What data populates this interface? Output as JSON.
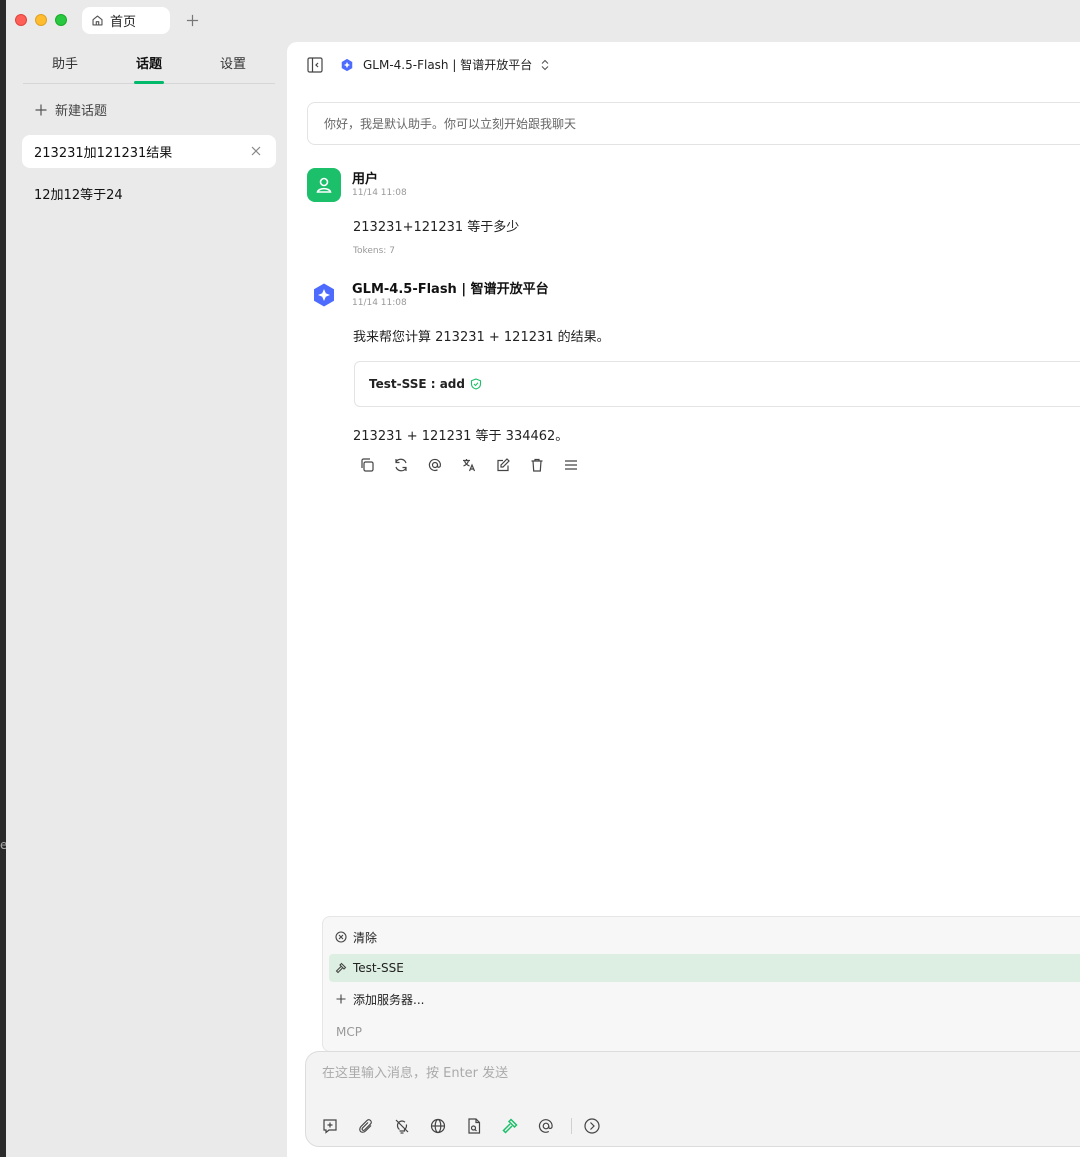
{
  "titlebar": {
    "tab_label": "首页",
    "new_tab_icon": "plus-icon"
  },
  "sidebar": {
    "tabs": [
      {
        "label": "助手",
        "active": false
      },
      {
        "label": "话题",
        "active": true
      },
      {
        "label": "设置",
        "active": false
      }
    ],
    "new_topic_label": "新建话题",
    "topics": [
      {
        "label": "213231加121231结果",
        "active": true
      },
      {
        "label": "12加12等于24",
        "active": false
      }
    ]
  },
  "topbar": {
    "model_name": "GLM-4.5-Flash | 智谱开放平台"
  },
  "greeting": "你好，我是默认助手。你可以立刻开始跟我聊天",
  "messages": {
    "user": {
      "sender": "用户",
      "time": "11/14 11:08",
      "content": "213231+121231 等于多少",
      "tokens": "Tokens: 7"
    },
    "assistant": {
      "sender": "GLM-4.5-Flash | 智谱开放平台",
      "time": "11/14 11:08",
      "intro": "我来帮您计算 213231 + 121231 的结果。",
      "tool_call": "Test-SSE : add",
      "result": "213231 + 121231 等于 334462。"
    }
  },
  "mcp_popup": {
    "items": [
      {
        "label": "清除",
        "icon": "clear-circle-icon"
      },
      {
        "label": "Test-SSE",
        "icon": "hammer-icon",
        "highlighted": true
      },
      {
        "label": "添加服务器...",
        "icon": "plus-icon"
      }
    ],
    "title": "MCP"
  },
  "input": {
    "placeholder": "在这里输入消息，按 Enter 发送"
  },
  "colors": {
    "accent": "#00b96b",
    "user_avatar": "#1cbf6a",
    "highlight": "#ddefe3"
  },
  "side_letter": "e"
}
